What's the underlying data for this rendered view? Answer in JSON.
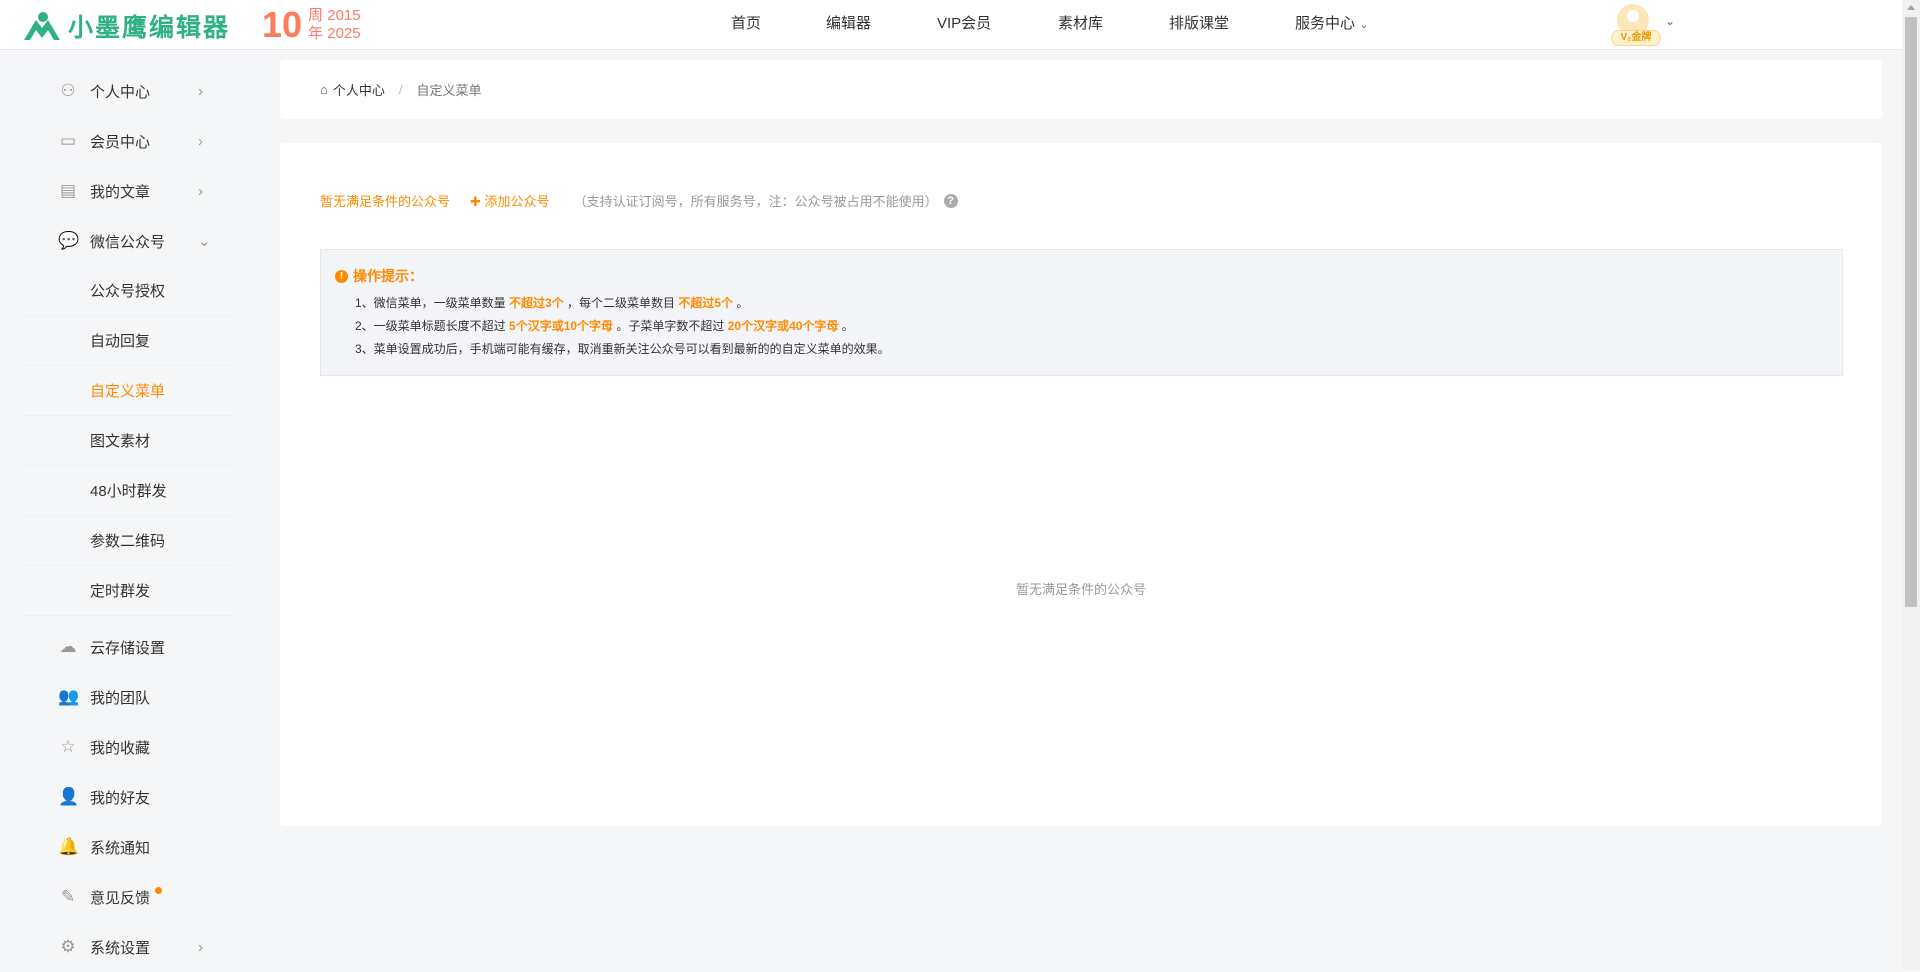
{
  "header": {
    "logo_text": "小墨鹰编辑器",
    "anniversary": {
      "number": "10",
      "zhou": "周",
      "nian": "年",
      "year_start": "2015",
      "year_end": "2025"
    },
    "nav": [
      {
        "label": "首页"
      },
      {
        "label": "编辑器"
      },
      {
        "label": "VIP会员"
      },
      {
        "label": "素材库"
      },
      {
        "label": "排版课堂"
      },
      {
        "label": "服务中心"
      }
    ],
    "dropdown_chevron": "⌄",
    "user_badge": "V₂金牌"
  },
  "sidebar": {
    "items": [
      {
        "label": "个人中心",
        "icon": "user-icon"
      },
      {
        "label": "会员中心",
        "icon": "card-icon"
      },
      {
        "label": "我的文章",
        "icon": "document-icon"
      },
      {
        "label": "微信公众号",
        "icon": "chat-icon"
      },
      {
        "label": "云存储设置",
        "icon": "cloud-icon"
      },
      {
        "label": "我的团队",
        "icon": "team-icon"
      },
      {
        "label": "我的收藏",
        "icon": "star-icon"
      },
      {
        "label": "我的好友",
        "icon": "add-friend-icon"
      },
      {
        "label": "系统通知",
        "icon": "bell-icon"
      },
      {
        "label": "意见反馈",
        "icon": "edit-icon"
      },
      {
        "label": "系统设置",
        "icon": "gear-icon"
      }
    ],
    "sub_items": [
      {
        "label": "公众号授权"
      },
      {
        "label": "自动回复"
      },
      {
        "label": "自定义菜单",
        "active": true
      },
      {
        "label": "图文素材"
      },
      {
        "label": "48小时群发"
      },
      {
        "label": "参数二维码"
      },
      {
        "label": "定时群发"
      }
    ]
  },
  "breadcrumb": {
    "home": "个人中心",
    "separator": "/",
    "current": "自定义菜单"
  },
  "main": {
    "no_account": "暂无满足条件的公众号",
    "add_account": "添加公众号",
    "support_note": "（支持认证订阅号，所有服务号，注：公众号被占用不能使用）",
    "notice": {
      "title": "操作提示：",
      "line1": {
        "a": "1、微信菜单，一级菜单数量 ",
        "b": "不超过3个",
        "c": " ，每个二级菜单数目 ",
        "d": "不超过5个",
        "e": " 。"
      },
      "line2": {
        "a": "2、一级菜单标题长度不超过 ",
        "b": "5个汉字或10个字母",
        "c": " 。子菜单字数不超过 ",
        "d": "20个汉字或40个字母",
        "e": " 。"
      },
      "line3": "3、菜单设置成功后，手机端可能有缓存，取消重新关注公众号可以看到最新的的自定义菜单的效果。"
    },
    "empty_text": "暂无满足条件的公众号"
  },
  "colors": {
    "accent": "#ff8a00",
    "brand": "#2fb184",
    "background": "#f5f6f8"
  }
}
